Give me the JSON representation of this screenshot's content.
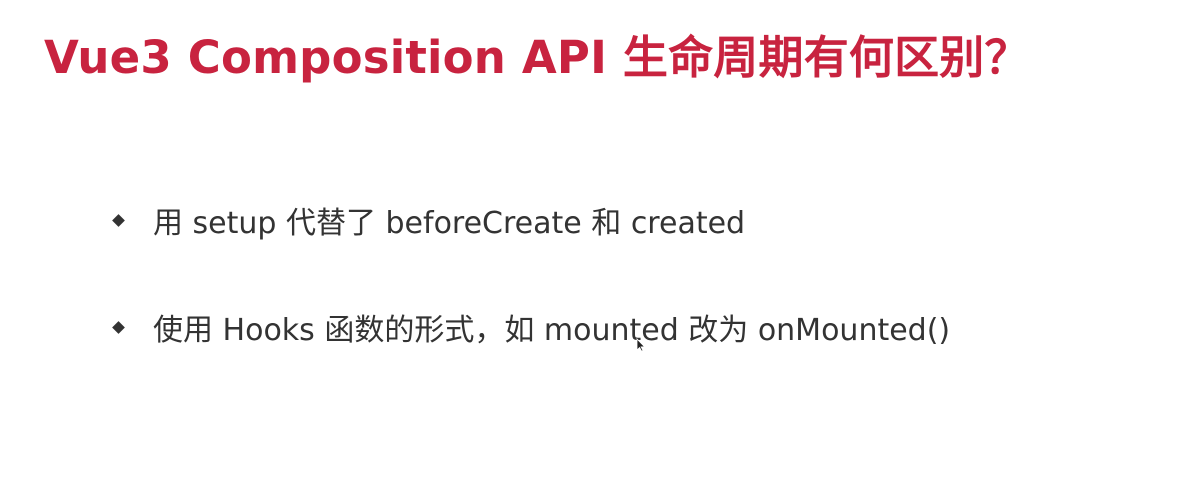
{
  "slide": {
    "title": "Vue3 Composition API 生命周期有何区别？",
    "bullets": [
      {
        "text": "用 setup 代替了 beforeCreate 和 created"
      },
      {
        "text": "使用 Hooks 函数的形式，如 mounted 改为 onMounted()"
      }
    ],
    "colors": {
      "title": "#c8233f",
      "text": "#333333",
      "background": "#ffffff"
    }
  },
  "icons": {
    "bullet": "diamond-bullet-icon",
    "cursor": "mouse-pointer-icon"
  }
}
